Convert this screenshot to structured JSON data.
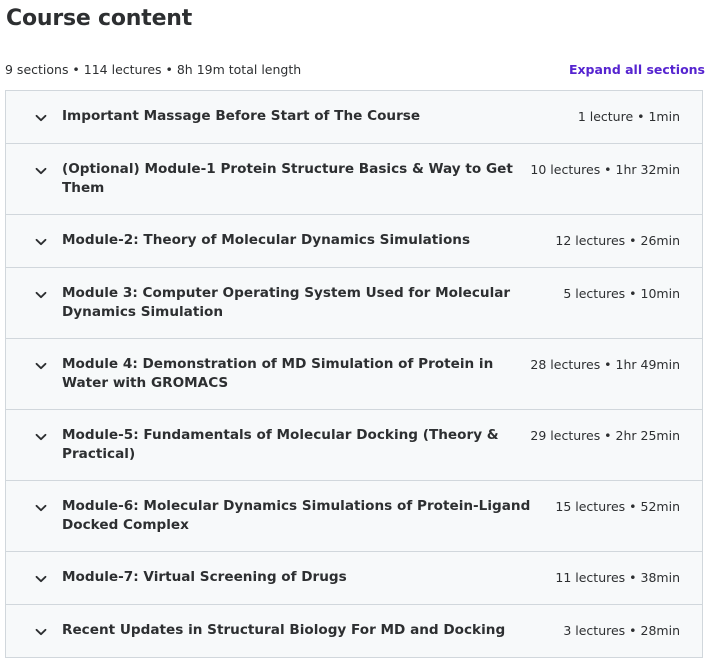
{
  "title": "Course content",
  "summary": "9 sections • 114 lectures • 8h 19m total length",
  "expand_all_label": "Expand all sections",
  "sections": [
    {
      "title": "Important Massage Before Start of The Course",
      "meta": "1 lecture • 1min"
    },
    {
      "title": "(Optional) Module-1 Protein Structure Basics & Way to Get Them",
      "meta": "10 lectures • 1hr 32min"
    },
    {
      "title": "Module-2: Theory of Molecular Dynamics Simulations",
      "meta": "12 lectures • 26min"
    },
    {
      "title": "Module 3: Computer Operating System Used for Molecular Dynamics Simulation",
      "meta": "5 lectures • 10min"
    },
    {
      "title": "Module 4: Demonstration of MD Simulation of Protein in Water with GROMACS",
      "meta": "28 lectures • 1hr 49min"
    },
    {
      "title": "Module-5: Fundamentals of Molecular Docking (Theory & Practical)",
      "meta": "29 lectures • 2hr 25min"
    },
    {
      "title": "Module-6: Molecular Dynamics Simulations of Protein-Ligand Docked Complex",
      "meta": "15 lectures • 52min"
    },
    {
      "title": "Module-7: Virtual Screening of Drugs",
      "meta": "11 lectures • 38min"
    },
    {
      "title": "Recent Updates in Structural Biology For MD and Docking",
      "meta": "3 lectures • 28min"
    }
  ],
  "icons": {
    "section_toggle": "chevron-down-icon"
  },
  "colors": {
    "text": "#2d2f31",
    "link": "#5624d0",
    "section_bg": "#f7f9fa",
    "border": "#d1d7dc"
  }
}
